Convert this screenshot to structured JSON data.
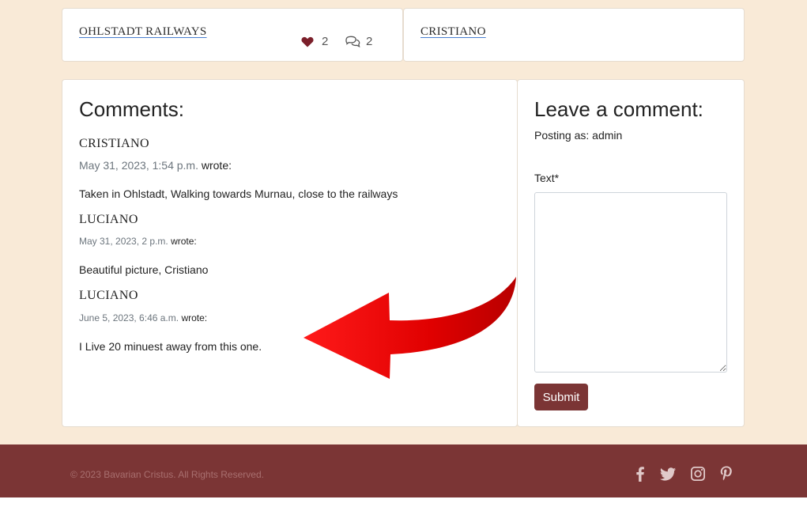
{
  "post": {
    "title": "OHLSTADT RAILWAYS",
    "likes": "2",
    "comment_count": "2",
    "author": "CRISTIANO"
  },
  "comments": {
    "heading": "Comments:",
    "items": [
      {
        "author": "CRISTIANO",
        "date": "May 31, 2023, 1:54 p.m.",
        "wrote": "wrote:",
        "body": "Taken in Ohlstadt, Walking towards Murnau, close to the railways"
      },
      {
        "author": "LUCIANO",
        "date": "May 31, 2023, 2 p.m.",
        "wrote": "wrote:",
        "body": "Beautiful picture, Cristiano"
      },
      {
        "author": "LUCIANO",
        "date": "June 5, 2023, 6:46 a.m.",
        "wrote": "wrote:",
        "body": "I Live 20 minuest away from this one."
      }
    ]
  },
  "form": {
    "heading": "Leave a comment:",
    "posting_as": "Posting as: admin",
    "text_label": "Text*",
    "text_value": "",
    "submit_label": "Submit"
  },
  "footer": {
    "copyright": "© 2023 Bavarian Cristus. All Rights Reserved.",
    "social": [
      "facebook-icon",
      "twitter-icon",
      "instagram-icon",
      "pinterest-icon"
    ]
  },
  "colors": {
    "background": "#f9ead7",
    "brand": "#7b3535",
    "heart": "#7b1f2a",
    "arrow": "#e00000"
  }
}
